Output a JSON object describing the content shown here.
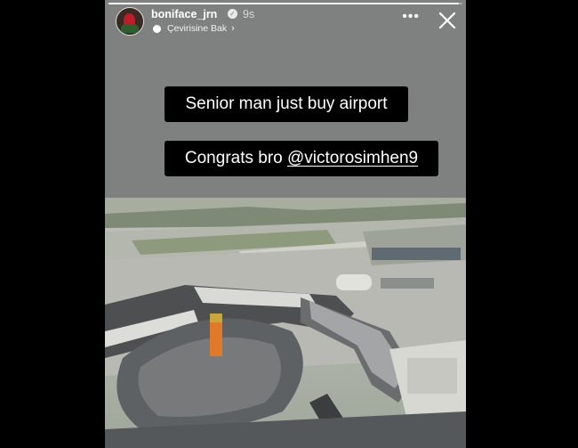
{
  "story": {
    "username": "boniface_jrn",
    "time": "9s",
    "translate_label": "Çevirisine Bak",
    "progress": 0.99,
    "captions": {
      "line1": "Senior man just buy airport",
      "line2_prefix": "Congrats bro ",
      "line2_mention": "@victorosimhen9"
    }
  },
  "icons": {
    "verified": "verified-badge-icon",
    "more": "more-options-icon",
    "close": "close-icon",
    "chevron": "chevron-right-icon",
    "translate": "translate-dot-icon"
  },
  "colors": {
    "background": "#000000",
    "story_bg": "#7f8080",
    "caption_bg": "#000000",
    "text": "#ffffff"
  }
}
